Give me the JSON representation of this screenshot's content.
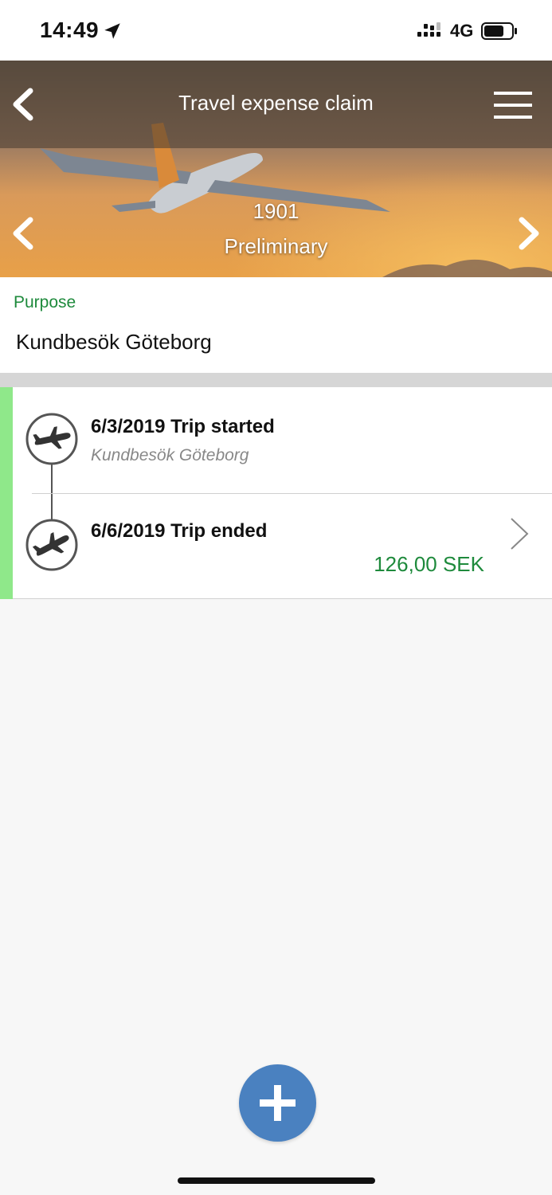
{
  "status_bar": {
    "time": "14:49",
    "network": "4G",
    "icons": [
      "location-arrow-icon",
      "signal-icon",
      "battery-icon"
    ]
  },
  "header": {
    "title": "Travel expense claim",
    "claim_number": "1901",
    "status": "Preliminary",
    "icons": [
      "back-icon",
      "menu-icon",
      "prev-icon",
      "next-icon"
    ]
  },
  "purpose": {
    "label": "Purpose",
    "value": "Kundbesök Göteborg"
  },
  "trips": [
    {
      "title": "6/3/2019 Trip started",
      "subtitle": "Kundbesök Göteborg",
      "icon": "plane-takeoff-icon"
    },
    {
      "title": "6/6/2019 Trip ended",
      "amount": "126,00 SEK",
      "icon": "plane-landing-icon"
    }
  ],
  "colors": {
    "accent_green": "#1e8a3c",
    "status_bar_green": "#8fe88a",
    "fab_blue": "#4a81c0"
  },
  "fab": {
    "icon": "plus-icon"
  }
}
